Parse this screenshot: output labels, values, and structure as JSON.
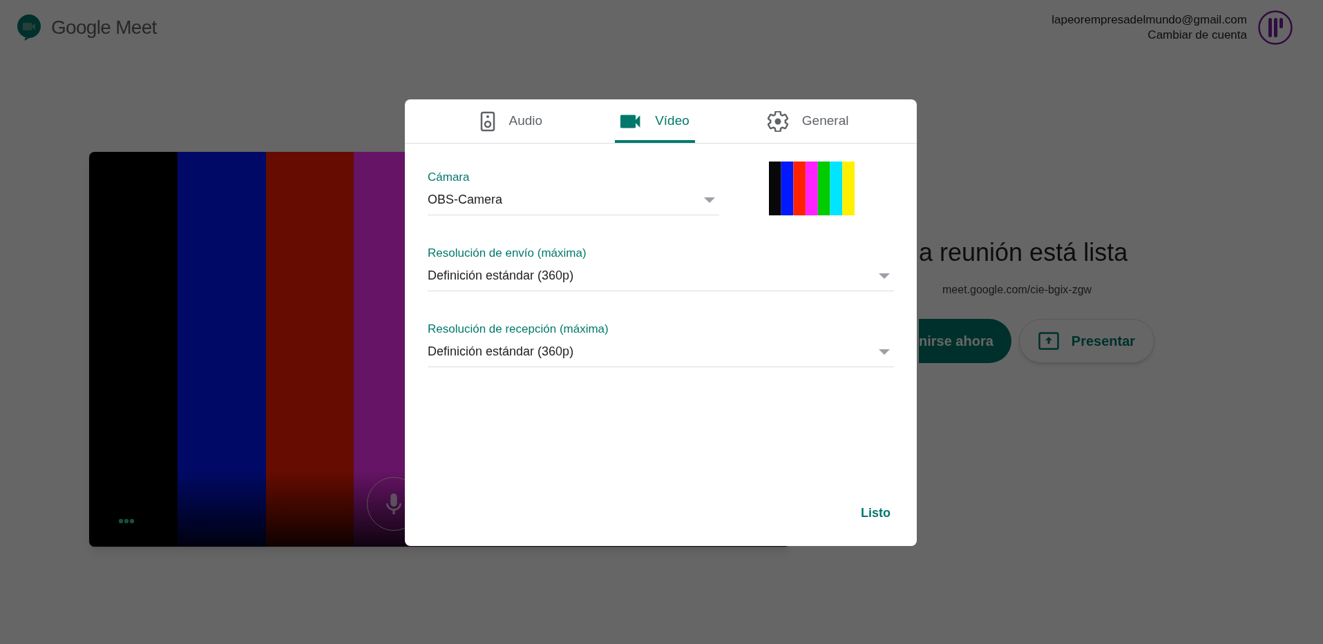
{
  "header": {
    "product_name": "Google Meet",
    "account_email": "lapeorempresadelmundo@gmail.com",
    "switch_account": "Cambiar de cuenta"
  },
  "meeting": {
    "heading": "a reunión está lista",
    "link": "meet.google.com/cie-bgix-zgw",
    "buttons": [
      {
        "label": "nirse ahora",
        "kind": "join"
      },
      {
        "label": "Presentar",
        "kind": "present"
      }
    ]
  },
  "dialog": {
    "tabs": [
      {
        "label": "Audio",
        "kind": "audio",
        "selected": false
      },
      {
        "label": "Vídeo",
        "kind": "video",
        "selected": true
      },
      {
        "label": "General",
        "kind": "general",
        "selected": false
      }
    ],
    "fields": [
      {
        "label": "Cámara",
        "value": "OBS-Camera",
        "kind": "camera"
      },
      {
        "label": "Resolución de envío (máxima)",
        "value": "Definición estándar (360p)",
        "kind": "resolution"
      },
      {
        "label": "Resolución de recepción (máxima)",
        "value": "Definición estándar (360p)",
        "kind": "resolution"
      }
    ],
    "done_button": "Listo"
  }
}
